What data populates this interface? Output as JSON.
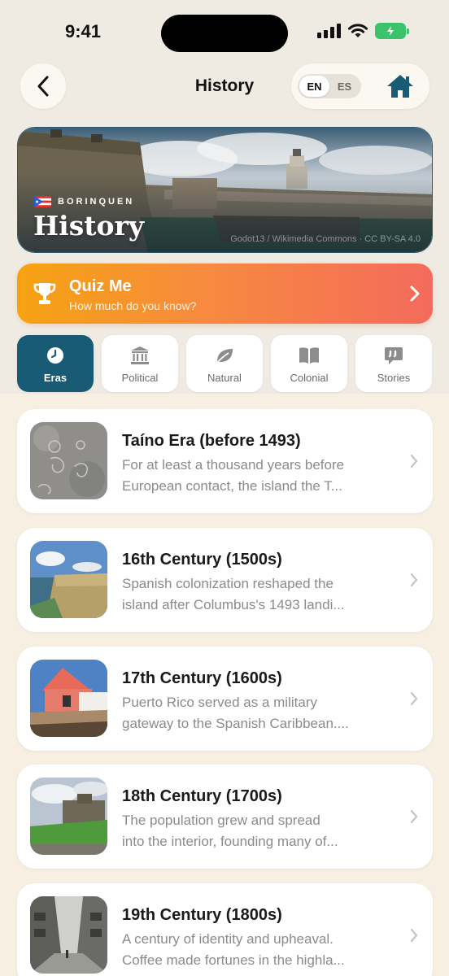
{
  "status_bar": {
    "time": "9:41"
  },
  "nav": {
    "title": "History",
    "lang_en": "EN",
    "lang_es": "ES",
    "active_lang": "EN",
    "icons": {
      "back": "chevron-left-icon",
      "home": "home-icon"
    }
  },
  "hero": {
    "kicker": "BORINQUEN",
    "title": "History",
    "credit": "Godot13 / Wikimedia Commons · CC BY-SA 4.0"
  },
  "quiz": {
    "title": "Quiz Me",
    "subtitle": "How much do you know?",
    "icon": "trophy-icon"
  },
  "tabs": [
    {
      "label": "Eras",
      "icon": "clock-icon",
      "active": true
    },
    {
      "label": "Political",
      "icon": "government-building-icon",
      "active": false
    },
    {
      "label": "Natural",
      "icon": "leaf-icon",
      "active": false
    },
    {
      "label": "Colonial",
      "icon": "book-icon",
      "active": false
    },
    {
      "label": "Stories",
      "icon": "speech-bubble-icon",
      "active": false
    }
  ],
  "eras": [
    {
      "title": "Taíno Era (before 1493)",
      "line1": "For at least a thousand years before",
      "line2": "European contact, the island the T..."
    },
    {
      "title": "16th Century (1500s)",
      "line1": "Spanish colonization reshaped the",
      "line2": "island after Columbus's 1493 landi..."
    },
    {
      "title": "17th Century (1600s)",
      "line1": "Puerto Rico served as a military",
      "line2": "gateway to the Spanish Caribbean...."
    },
    {
      "title": "18th Century (1700s)",
      "line1": "The population grew and spread",
      "line2": "into the interior, founding many of..."
    },
    {
      "title": "19th Century (1800s)",
      "line1": "A century of identity and upheaval.",
      "line2": "Coffee made fortunes in the highla..."
    }
  ],
  "colors": {
    "accent": "#195b74",
    "quiz_gradient_start": "#f6a312",
    "quiz_gradient_end": "#f46a5c",
    "battery": "#3ac36a"
  }
}
